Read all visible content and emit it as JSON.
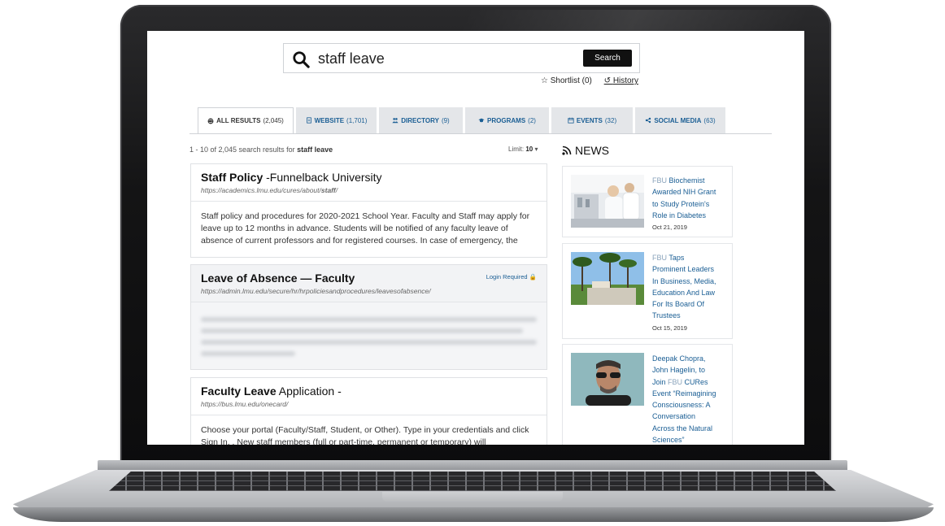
{
  "search": {
    "query": "staff leave",
    "button_label": "Search"
  },
  "tools": {
    "shortlist": "☆ Shortlist (0)",
    "history": "History"
  },
  "tabs": [
    {
      "label": "ALL RESULTS",
      "count": "(2,045)",
      "icon": "globe-icon",
      "active": true
    },
    {
      "label": "WEBSITE",
      "count": "(1,701)",
      "icon": "document-icon"
    },
    {
      "label": "DIRECTORY",
      "count": "(9)",
      "icon": "users-icon"
    },
    {
      "label": "PROGRAMS",
      "count": "(2)",
      "icon": "graduation-cap-icon"
    },
    {
      "label": "EVENTS",
      "count": "(32)",
      "icon": "calendar-icon"
    },
    {
      "label": "SOCIAL MEDIA",
      "count": "(63)",
      "icon": "share-icon"
    }
  ],
  "results_meta": {
    "summary_prefix": "1 - 10 of 2,045 search results for",
    "summary_query": "staff leave",
    "limit_label": "Limit:",
    "limit_value": "10"
  },
  "results": [
    {
      "title_bold": "Staff Policy",
      "title_rest": " -Funnelback University",
      "url_prefix": "https://academics.lmu.edu/cures/about/",
      "url_bold": "staff",
      "url_suffix": "/",
      "description": "Staff policy and procedures for 2020-2021 School Year. Faculty and Staff may apply for leave up to 12 months in advance. Students will be notified of any faculty leave of absence of current professors and for registered courses. In case of emergency, the"
    },
    {
      "title_bold": "Leave of Absence — Faculty",
      "url_prefix": "https://admin.lmu.edu/secure/hr/hrpoliciesandprocedures/leavesofabsence/",
      "login_required": "Login Required",
      "description_hidden": "Text has been modified due to secure contents."
    },
    {
      "title_bold": "Faculty Leave",
      "title_rest": " Application -",
      "url_prefix": "https://bus.lmu.edu/onecard/",
      "description": "Choose your portal  (Faculty/Staff, Student, or Other). Type in your credentials and click Sign In. . New staff members (full or part-time, permanent or temporary) will"
    }
  ],
  "news": {
    "heading": "NEWS",
    "items": [
      {
        "lines": [
          "FBU Biochemist",
          "Awarded NIH Grant",
          "to Study Protein's",
          "Role in Diabetes"
        ],
        "date": "Oct 21, 2019"
      },
      {
        "lines": [
          "FBU Taps",
          "Prominent Leaders",
          "In Business, Media,",
          "Education And Law",
          "For Its Board Of",
          "Trustees"
        ],
        "date": "Oct 15, 2019"
      },
      {
        "lines": [
          "Deepak Chopra,",
          "John Hagelin, to",
          "Join FBU CURes",
          "Event “Reimagining",
          "Consciousness: A",
          "Conversation",
          "Across the Natural",
          "Sciences”"
        ]
      }
    ]
  },
  "colors": {
    "link_blue": "#1a5e94",
    "button_black": "#111111",
    "tab_gray": "#e4e6e9"
  }
}
